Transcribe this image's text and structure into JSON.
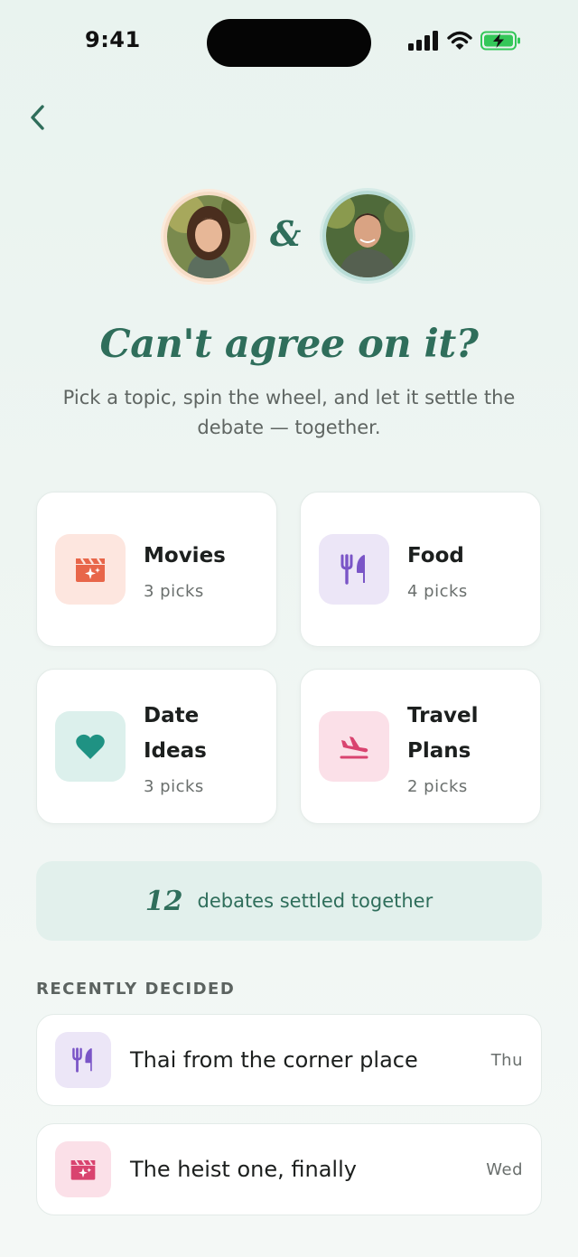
{
  "status_bar": {
    "time": "9:41"
  },
  "couple": {
    "ampersand": "&"
  },
  "headline": "Can't agree on it?",
  "subtitle": "Pick a topic, spin the wheel, and let it settle the debate — together.",
  "categories": [
    {
      "title_line1": "Movies",
      "title_line2": "",
      "picks": "3 picks",
      "icon": "clapperboard-sparkle-icon",
      "icon_bg": "#fde6df",
      "icon_color": "#e8664a"
    },
    {
      "title_line1": "Food",
      "title_line2": "",
      "picks": "4 picks",
      "icon": "fork-knife-icon",
      "icon_bg": "#ece6f7",
      "icon_color": "#7a55c7"
    },
    {
      "title_line1": "Date",
      "title_line2": "Ideas",
      "picks": "3 picks",
      "icon": "heart-icon",
      "icon_bg": "#dcf0ec",
      "icon_color": "#1f9283"
    },
    {
      "title_line1": "Travel",
      "title_line2": "Plans",
      "picks": "2 picks",
      "icon": "airplane-landing-icon",
      "icon_bg": "#fbe0e8",
      "icon_color": "#d9436f"
    }
  ],
  "stats": {
    "count": "12",
    "label": "debates settled together"
  },
  "recent": {
    "section_label": "RECENTLY DECIDED",
    "items": [
      {
        "title": "Thai from the corner place",
        "day": "Thu",
        "icon": "fork-knife-icon",
        "icon_bg": "#ece6f7"
      },
      {
        "title": "The heist one, finally",
        "day": "Wed",
        "icon": "clapperboard-sparkle-icon",
        "icon_bg": "#fbe0e8"
      }
    ]
  },
  "colors": {
    "brand_green": "#2f6e5b",
    "background": "#eef5f2"
  }
}
